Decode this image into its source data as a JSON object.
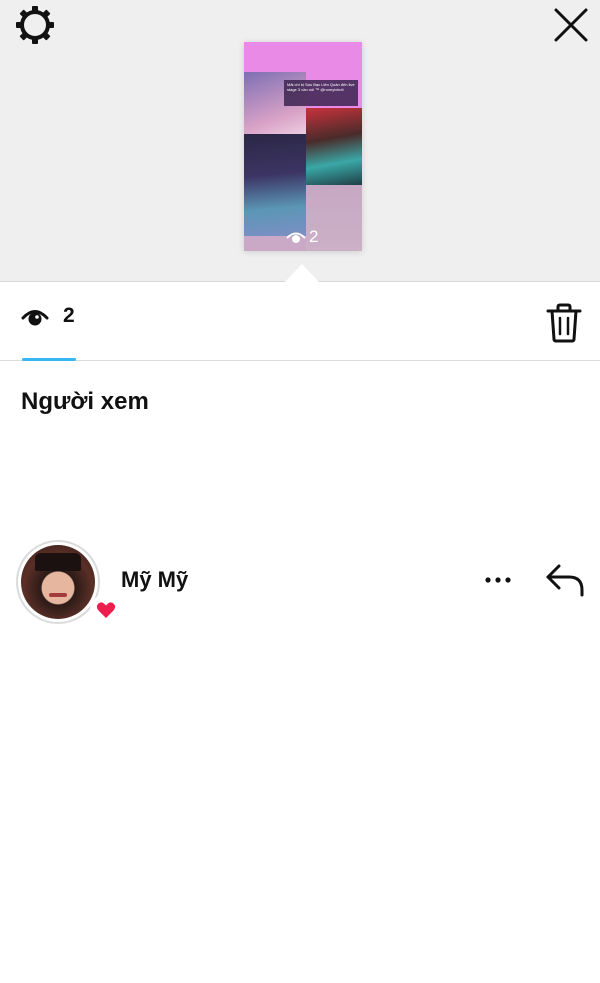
{
  "story_preview": {
    "caption": "Mãi chi bị Sao Bạc Liên Quân đến live stage 3 cần nói ™ @nomyixiruti",
    "view_count": "2"
  },
  "tabs": {
    "views_count": "2"
  },
  "section": {
    "title": "Người xem"
  },
  "viewers": [
    {
      "name": "Mỹ Mỹ",
      "reaction": "heart-icon"
    }
  ],
  "colors": {
    "accent_underline": "#38b8f2",
    "heart": "#ed1e4e",
    "top_background": "#efefef"
  }
}
